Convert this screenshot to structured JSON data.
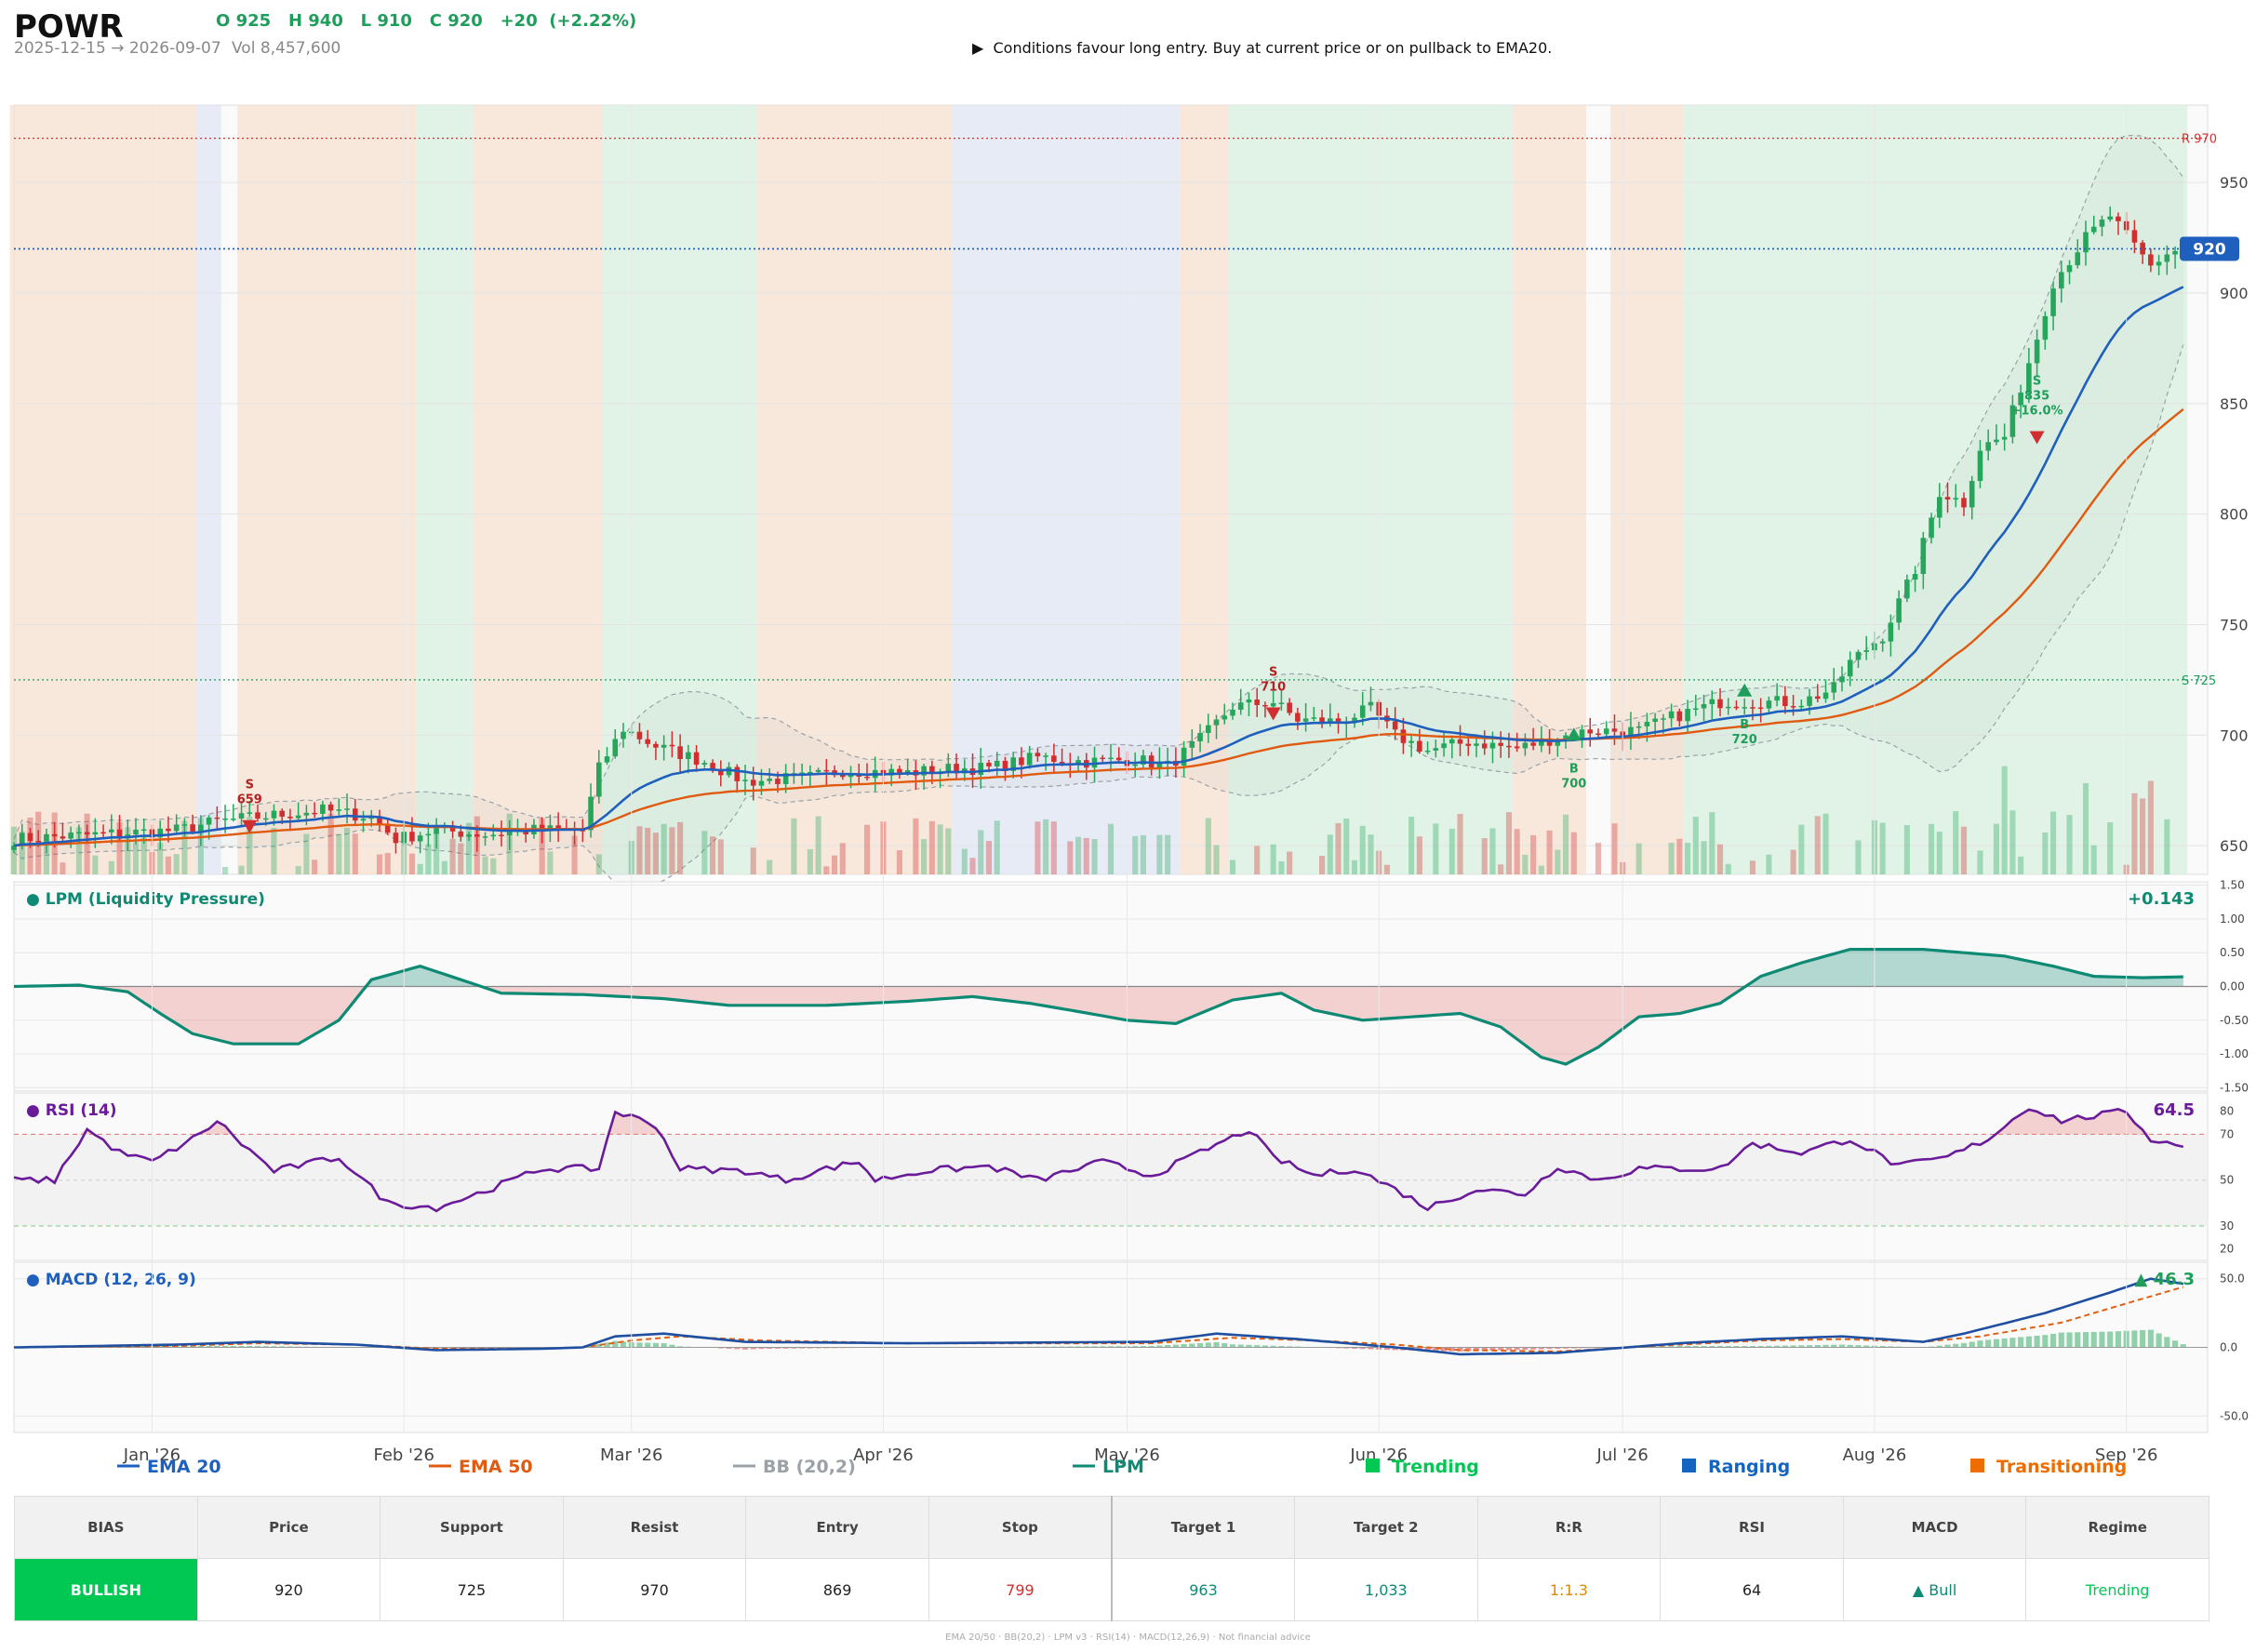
{
  "header": {
    "symbol": "POWR",
    "ohlc": "O 925   H 940   L 910   C 920   +20  (+2.22%)",
    "date_range": "2025-12-15 → 2026-09-07",
    "volume": "Vol 8,457,600",
    "signal_text": "▶  Conditions favour long entry. Buy at current price or on pullback to EMA20."
  },
  "colors": {
    "up": "#26a65b",
    "down": "#d12f2f",
    "ema20": "#1f5fbd",
    "ema50": "#e05a10",
    "bb": "#9aa2a8",
    "lpm": "#0e8a74",
    "rsi": "#6a1b9a",
    "macd": "#1f4fa0",
    "signal": "#e06010",
    "trending": "#00c853",
    "ranging": "#1565c0",
    "transitioning": "#ef6c00"
  },
  "chart_data": [
    {
      "type": "candlestick",
      "title": "POWR",
      "x_ticks": [
        "Jan '26",
        "Feb '26",
        "Mar '26",
        "Apr '26",
        "May '26",
        "Jun '26",
        "Jul '26",
        "Aug '26",
        "Sep '26"
      ],
      "x_tick_days": [
        17,
        48,
        76,
        107,
        137,
        168,
        198,
        229,
        260
      ],
      "y_ticks": [
        650,
        700,
        750,
        800,
        850,
        900,
        950
      ],
      "ylim": [
        637,
        985
      ],
      "xlim": [
        0,
        270
      ],
      "last_price": 920,
      "last_price_label": "920",
      "resistance": {
        "value": 970,
        "label": "R 970"
      },
      "support": {
        "value": 725,
        "label": "S 725"
      },
      "anchors": [
        [
          0,
          653
        ],
        [
          10,
          655
        ],
        [
          20,
          657
        ],
        [
          25,
          661
        ],
        [
          30,
          663
        ],
        [
          38,
          666
        ],
        [
          44,
          663
        ],
        [
          47,
          653
        ],
        [
          52,
          657
        ],
        [
          58,
          655
        ],
        [
          64,
          657
        ],
        [
          70,
          657
        ],
        [
          72,
          685
        ],
        [
          75,
          703
        ],
        [
          79,
          695
        ],
        [
          85,
          688
        ],
        [
          90,
          679
        ],
        [
          98,
          681
        ],
        [
          102,
          684
        ],
        [
          110,
          683
        ],
        [
          116,
          685
        ],
        [
          120,
          685
        ],
        [
          126,
          690
        ],
        [
          132,
          688
        ],
        [
          138,
          689
        ],
        [
          142,
          686
        ],
        [
          146,
          698
        ],
        [
          150,
          713
        ],
        [
          155,
          715
        ],
        [
          158,
          707
        ],
        [
          163,
          706
        ],
        [
          167,
          712
        ],
        [
          170,
          700
        ],
        [
          174,
          693
        ],
        [
          179,
          697
        ],
        [
          185,
          694
        ],
        [
          189,
          698
        ],
        [
          194,
          702
        ],
        [
          200,
          702
        ],
        [
          204,
          708
        ],
        [
          210,
          715
        ],
        [
          215,
          715
        ],
        [
          220,
          715
        ],
        [
          224,
          721
        ],
        [
          226,
          733
        ],
        [
          230,
          745
        ],
        [
          234,
          775
        ],
        [
          237,
          810
        ],
        [
          240,
          805
        ],
        [
          242,
          830
        ],
        [
          245,
          835
        ],
        [
          249,
          880
        ],
        [
          251,
          905
        ],
        [
          253,
          915
        ],
        [
          255,
          925
        ],
        [
          258,
          935
        ],
        [
          261,
          921
        ],
        [
          263,
          912
        ],
        [
          265,
          918
        ],
        [
          267,
          920
        ]
      ],
      "regimes": [
        {
          "start": 0,
          "end": 22,
          "regime": "Transitioning"
        },
        {
          "start": 23,
          "end": 25,
          "regime": "Ranging"
        },
        {
          "start": 28,
          "end": 49,
          "regime": "Transitioning"
        },
        {
          "start": 50,
          "end": 56,
          "regime": "Trending"
        },
        {
          "start": 57,
          "end": 72,
          "regime": "Transitioning"
        },
        {
          "start": 73,
          "end": 91,
          "regime": "Trending"
        },
        {
          "start": 92,
          "end": 115,
          "regime": "Transitioning"
        },
        {
          "start": 116,
          "end": 143,
          "regime": "Ranging"
        },
        {
          "start": 144,
          "end": 149,
          "regime": "Transitioning"
        },
        {
          "start": 150,
          "end": 184,
          "regime": "Trending"
        },
        {
          "start": 185,
          "end": 193,
          "regime": "Transitioning"
        },
        {
          "start": 197,
          "end": 205,
          "regime": "Transitioning"
        },
        {
          "start": 206,
          "end": 267,
          "regime": "Trending"
        }
      ],
      "trade_markers": [
        {
          "day": 29,
          "side": "S",
          "price": 659,
          "label": "S",
          "value": "659"
        },
        {
          "day": 155,
          "side": "S",
          "price": 710,
          "label": "S",
          "value": "710"
        },
        {
          "day": 192,
          "side": "B",
          "price": 700,
          "label": "B",
          "value": "700"
        },
        {
          "day": 213,
          "side": "B",
          "price": 720,
          "label": "B",
          "value": "720"
        },
        {
          "day": 249,
          "side": "S",
          "price": 835,
          "label": "S",
          "value": "835",
          "extra": "+16.0%"
        }
      ]
    },
    {
      "type": "area",
      "title": "LPM (Liquidity Pressure)",
      "last_value": "+0.143",
      "y_ticks": [
        1.5,
        1.0,
        0.5,
        0.0,
        -0.5,
        -1.0,
        -1.5
      ],
      "y_tick_labels": [
        "1.50",
        "1.00",
        "0.50",
        "0.00",
        "-0.50",
        "-1.00",
        "-1.50"
      ],
      "ylim": [
        -1.55,
        1.55
      ],
      "anchors": [
        [
          0,
          0.0
        ],
        [
          8,
          0.02
        ],
        [
          14,
          -0.08
        ],
        [
          18,
          -0.4
        ],
        [
          22,
          -0.7
        ],
        [
          27,
          -0.85
        ],
        [
          35,
          -0.85
        ],
        [
          40,
          -0.5
        ],
        [
          44,
          0.1
        ],
        [
          50,
          0.3
        ],
        [
          53,
          0.18
        ],
        [
          60,
          -0.1
        ],
        [
          70,
          -0.12
        ],
        [
          80,
          -0.18
        ],
        [
          88,
          -0.28
        ],
        [
          100,
          -0.28
        ],
        [
          110,
          -0.22
        ],
        [
          118,
          -0.15
        ],
        [
          125,
          -0.25
        ],
        [
          130,
          -0.35
        ],
        [
          137,
          -0.5
        ],
        [
          143,
          -0.55
        ],
        [
          150,
          -0.2
        ],
        [
          156,
          -0.1
        ],
        [
          160,
          -0.35
        ],
        [
          166,
          -0.5
        ],
        [
          172,
          -0.45
        ],
        [
          178,
          -0.4
        ],
        [
          183,
          -0.6
        ],
        [
          188,
          -1.05
        ],
        [
          191,
          -1.15
        ],
        [
          195,
          -0.9
        ],
        [
          200,
          -0.45
        ],
        [
          205,
          -0.4
        ],
        [
          210,
          -0.25
        ],
        [
          215,
          0.15
        ],
        [
          220,
          0.35
        ],
        [
          226,
          0.55
        ],
        [
          235,
          0.55
        ],
        [
          245,
          0.45
        ],
        [
          251,
          0.3
        ],
        [
          256,
          0.15
        ],
        [
          262,
          0.13
        ],
        [
          267,
          0.143
        ]
      ]
    },
    {
      "type": "line",
      "title": "RSI (14)",
      "last_value": "64.5",
      "y_ticks": [
        80,
        70,
        50,
        30,
        20
      ],
      "ylim": [
        15,
        88
      ],
      "overbought": 70,
      "oversold": 30,
      "anchors": [
        [
          0,
          50
        ],
        [
          5,
          50
        ],
        [
          9,
          72
        ],
        [
          13,
          62
        ],
        [
          17,
          58
        ],
        [
          23,
          70
        ],
        [
          25,
          76
        ],
        [
          28,
          66
        ],
        [
          32,
          54
        ],
        [
          40,
          60
        ],
        [
          46,
          40
        ],
        [
          52,
          38
        ],
        [
          57,
          44
        ],
        [
          65,
          55
        ],
        [
          72,
          55
        ],
        [
          74,
          80
        ],
        [
          79,
          74
        ],
        [
          82,
          55
        ],
        [
          90,
          54
        ],
        [
          95,
          50
        ],
        [
          100,
          55
        ],
        [
          104,
          58
        ],
        [
          106,
          50
        ],
        [
          112,
          54
        ],
        [
          120,
          56
        ],
        [
          126,
          50
        ],
        [
          134,
          58
        ],
        [
          140,
          52
        ],
        [
          146,
          62
        ],
        [
          152,
          72
        ],
        [
          155,
          60
        ],
        [
          160,
          52
        ],
        [
          165,
          55
        ],
        [
          170,
          46
        ],
        [
          174,
          38
        ],
        [
          180,
          46
        ],
        [
          186,
          44
        ],
        [
          190,
          56
        ],
        [
          195,
          50
        ],
        [
          200,
          55
        ],
        [
          210,
          55
        ],
        [
          214,
          66
        ],
        [
          220,
          62
        ],
        [
          226,
          68
        ],
        [
          232,
          56
        ],
        [
          238,
          60
        ],
        [
          243,
          68
        ],
        [
          248,
          82
        ],
        [
          252,
          76
        ],
        [
          256,
          78
        ],
        [
          260,
          80
        ],
        [
          263,
          68
        ],
        [
          267,
          64.5
        ]
      ]
    },
    {
      "type": "line",
      "title": "MACD (12, 26, 9)",
      "last_value": "▲ 46.3",
      "y_ticks": [
        50,
        0,
        -50
      ],
      "y_tick_labels": [
        "50.0",
        "0.0",
        "-50.0"
      ],
      "ylim": [
        -62,
        62
      ],
      "series": [
        {
          "name": "MACD",
          "anchors": [
            [
              0,
              0
            ],
            [
              20,
              2
            ],
            [
              30,
              4
            ],
            [
              42,
              2
            ],
            [
              52,
              -2
            ],
            [
              65,
              -1
            ],
            [
              70,
              0
            ],
            [
              74,
              8
            ],
            [
              80,
              10
            ],
            [
              90,
              4
            ],
            [
              110,
              3
            ],
            [
              140,
              4
            ],
            [
              148,
              10
            ],
            [
              158,
              6
            ],
            [
              170,
              0
            ],
            [
              178,
              -5
            ],
            [
              190,
              -4
            ],
            [
              205,
              3
            ],
            [
              215,
              6
            ],
            [
              225,
              8
            ],
            [
              235,
              4
            ],
            [
              240,
              10
            ],
            [
              250,
              25
            ],
            [
              258,
              40
            ],
            [
              263,
              50
            ],
            [
              267,
              46.3
            ]
          ]
        },
        {
          "name": "Signal",
          "anchors": [
            [
              0,
              0
            ],
            [
              20,
              1
            ],
            [
              30,
              3
            ],
            [
              42,
              2
            ],
            [
              52,
              -1
            ],
            [
              65,
              -1
            ],
            [
              70,
              0
            ],
            [
              76,
              5
            ],
            [
              82,
              8
            ],
            [
              92,
              5
            ],
            [
              110,
              3
            ],
            [
              140,
              3
            ],
            [
              150,
              7
            ],
            [
              160,
              5
            ],
            [
              170,
              2
            ],
            [
              178,
              -2
            ],
            [
              190,
              -3
            ],
            [
              205,
              2
            ],
            [
              215,
              5
            ],
            [
              225,
              6
            ],
            [
              235,
              4
            ],
            [
              242,
              8
            ],
            [
              252,
              18
            ],
            [
              260,
              32
            ],
            [
              267,
              44
            ]
          ]
        }
      ]
    }
  ],
  "legend": [
    {
      "label": "EMA 20",
      "color": "#1f5fbd",
      "marker": "line"
    },
    {
      "label": "EMA 50",
      "color": "#e05a10",
      "marker": "line"
    },
    {
      "label": "BB (20,2)",
      "color": "#9aa2a8",
      "marker": "line"
    },
    {
      "label": "LPM",
      "color": "#0e8a74",
      "marker": "line"
    },
    {
      "label": "Trending",
      "color": "#00c853",
      "marker": "square"
    },
    {
      "label": "Ranging",
      "color": "#1565c0",
      "marker": "square"
    },
    {
      "label": "Transitioning",
      "color": "#ef6c00",
      "marker": "square"
    }
  ],
  "table": {
    "headers": [
      "BIAS",
      "Price",
      "Support",
      "Resist",
      "Entry",
      "Stop",
      "Target 1",
      "Target 2",
      "R:R",
      "RSI",
      "MACD",
      "Regime"
    ],
    "values": [
      "BULLISH",
      "920",
      "725",
      "970",
      "869",
      "799",
      "963",
      "1,033",
      "1:1.3",
      "64",
      "▲ Bull",
      "Trending"
    ],
    "value_colors": [
      "#ffffff",
      "#222222",
      "#222222",
      "#222222",
      "#222222",
      "#d12f2f",
      "#0e8a74",
      "#0e8a74",
      "#e08a00",
      "#222222",
      "#0e8a74",
      "#00c853"
    ]
  },
  "footer": "EMA 20/50  ·  BB(20,2)  ·  LPM v3  ·  RSI(14)  ·  MACD(12,26,9)  ·  Not financial advice"
}
